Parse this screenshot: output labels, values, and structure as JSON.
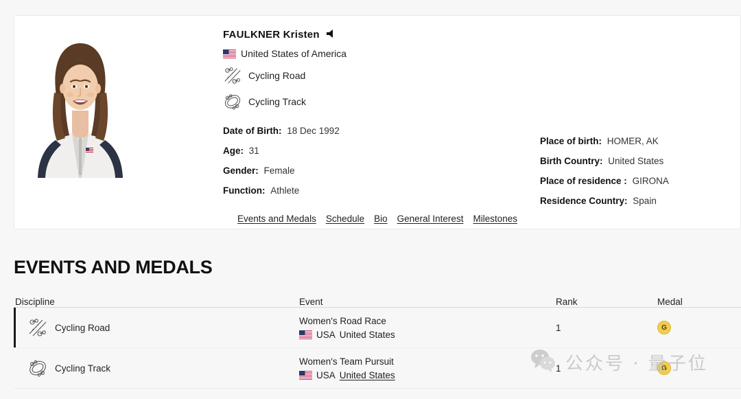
{
  "profile": {
    "name": "FAULKNER Kristen",
    "audio_icon": "speaker-icon",
    "country": "United States of America",
    "country_flag": "usa-flag-icon",
    "sports": [
      {
        "label": "Cycling Road",
        "icon": "cycling-road-icon"
      },
      {
        "label": "Cycling Track",
        "icon": "cycling-track-icon"
      }
    ],
    "facts_left": [
      {
        "label": "Date of Birth:",
        "value": "18 Dec 1992"
      },
      {
        "label": "Age:",
        "value": "31"
      },
      {
        "label": "Gender:",
        "value": "Female"
      },
      {
        "label": "Function:",
        "value": "Athlete"
      }
    ],
    "facts_right": [
      {
        "label": "Place of birth:",
        "value": "HOMER, AK"
      },
      {
        "label": "Birth Country:",
        "value": "United States"
      },
      {
        "label": "Place of residence :",
        "value": "GIRONA"
      },
      {
        "label": "Residence Country:",
        "value": "Spain"
      }
    ],
    "links": [
      "Events and Medals",
      "Schedule",
      "Bio",
      "General Interest",
      "Milestones"
    ]
  },
  "events_section": {
    "title": "EVENTS AND MEDALS",
    "columns": [
      "Discipline",
      "Event",
      "Rank",
      "Medal"
    ],
    "rows": [
      {
        "discipline": "Cycling Road",
        "discipline_icon": "cycling-road-icon",
        "event": "Women's Road Race",
        "team_code": "USA",
        "team_name": "United States",
        "team_flag": "usa-flag-icon",
        "team_underlined": false,
        "rank": "1",
        "medal": "G",
        "medal_color": "#f2cc52"
      },
      {
        "discipline": "Cycling Track",
        "discipline_icon": "cycling-track-icon",
        "event": "Women's Team Pursuit",
        "team_code": "USA",
        "team_name": "United States",
        "team_flag": "usa-flag-icon",
        "team_underlined": true,
        "rank": "1",
        "medal": "G",
        "medal_color": "#f2cc52"
      }
    ]
  },
  "watermark": {
    "icon": "wechat-icon",
    "text": "公众号 · 量子位"
  }
}
